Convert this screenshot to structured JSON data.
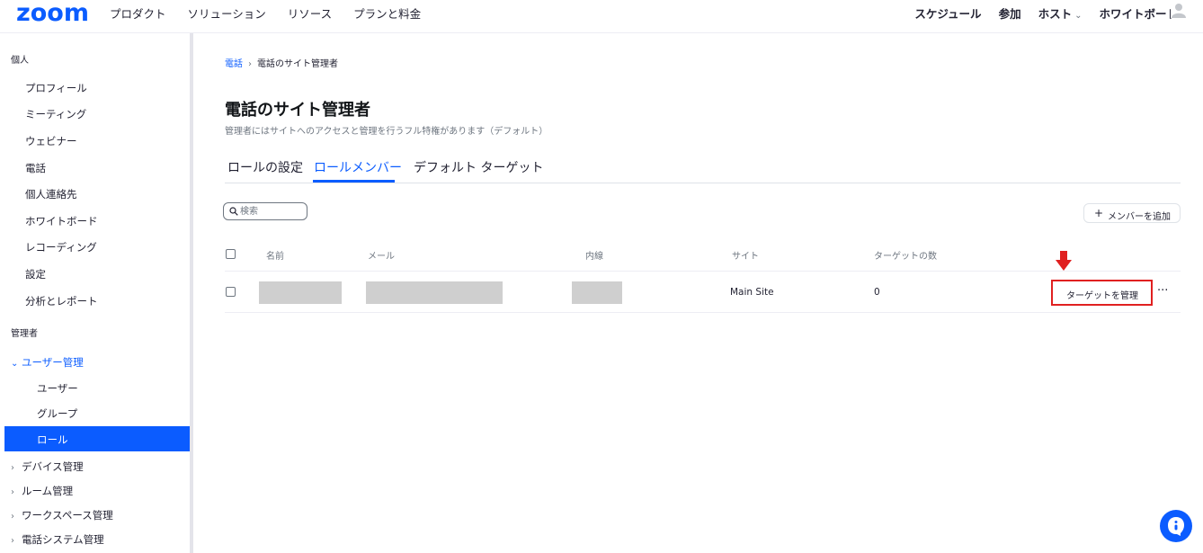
{
  "brand": {
    "logo": "zoom",
    "accent": "#0b5cff"
  },
  "topnav": {
    "left": [
      "プロダクト",
      "ソリューション",
      "リソース",
      "プランと料金"
    ],
    "right": {
      "schedule": "スケジュール",
      "join": "参加",
      "host": "ホスト",
      "whiteboard": "ホワイトボード"
    },
    "icons": [
      "chevron-down-icon",
      "user-avatar-icon"
    ]
  },
  "sidebar": {
    "personal_heading": "個人",
    "personal_items": [
      "プロフィール",
      "ミーティング",
      "ウェビナー",
      "電話",
      "個人連絡先",
      "ホワイトボード",
      "レコーディング",
      "設定",
      "分析とレポート"
    ],
    "admin_heading": "管理者",
    "user_mgmt": {
      "label": "ユーザー管理",
      "children": [
        "ユーザー",
        "グループ",
        "ロール"
      ],
      "selected": "ロール"
    },
    "collapsed": [
      "デバイス管理",
      "ルーム管理",
      "ワークスペース管理",
      "電話システム管理"
    ]
  },
  "breadcrumb": {
    "parent": "電話",
    "separator": "›",
    "current": "電話のサイト管理者"
  },
  "page": {
    "title": "電話のサイト管理者",
    "description": "管理者にはサイトへのアクセスと管理を行うフル特権があります（デフォルト）"
  },
  "tabs": {
    "items": [
      "ロールの設定",
      "ロールメンバー",
      "デフォルト ターゲット"
    ],
    "active": "ロールメンバー"
  },
  "toolbar": {
    "search_placeholder": "検索",
    "add_member": "メンバーを追加",
    "add_icon": "plus-icon"
  },
  "table": {
    "headers": [
      "名前",
      "メール",
      "内線",
      "サイト",
      "ターゲットの数"
    ],
    "rows": [
      {
        "name": "",
        "email": "",
        "extension": "",
        "site": "Main Site",
        "targets": "0",
        "action": "ターゲットを管理"
      }
    ]
  },
  "annotation": {
    "highlight_color": "#e02020",
    "icon": "down-arrow-icon"
  },
  "fab_icon": "chat-support-icon"
}
